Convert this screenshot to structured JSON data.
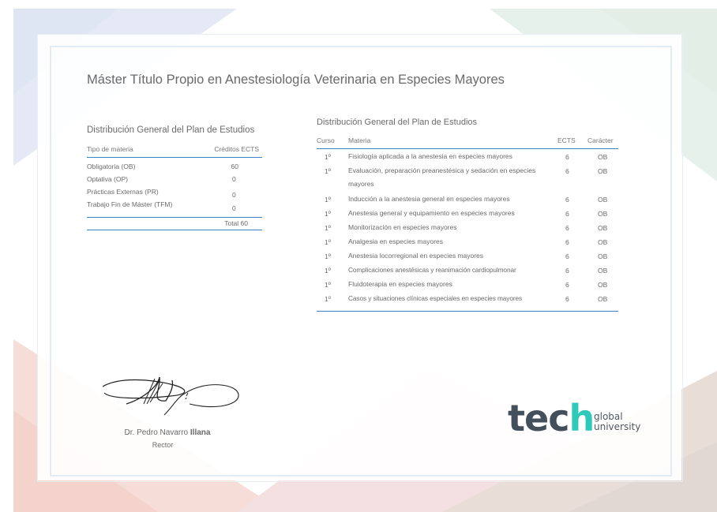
{
  "document": {
    "title": "Máster Título Propio en Anestesiología Veterinaria en Especies Mayores"
  },
  "summary_table": {
    "title": "Distribución General del Plan de Estudios",
    "headers": [
      "Tipo de materia",
      "Créditos ECTS"
    ],
    "rows": [
      {
        "type": "Obligatoria (OB)",
        "credits": "60"
      },
      {
        "type": "Optativa (OP)",
        "credits": "0"
      },
      {
        "type": "Prácticas Externas (PR)",
        "credits": "0"
      },
      {
        "type": "Trabajo Fin de Máster (TFM)",
        "credits": "0"
      }
    ],
    "total": "Total 60"
  },
  "plan_table": {
    "title": "Distribución General del Plan de Estudios",
    "headers": [
      "Curso",
      "Materia",
      "ECTS",
      "Carácter"
    ],
    "rows": [
      {
        "course": "1º",
        "subject": "Fisiología aplicada a la anestesia en especies mayores",
        "ects": "6",
        "type": "OB"
      },
      {
        "course": "1º",
        "subject": "Evaluación, preparación preanestésica y sedación en especies mayores",
        "ects": "6",
        "type": "OB"
      },
      {
        "course": "1º",
        "subject": "Inducción a la anestesia general en especies mayores",
        "ects": "6",
        "type": "OB"
      },
      {
        "course": "1º",
        "subject": "Anestesia general y equipamiento en especies mayores",
        "ects": "6",
        "type": "OB"
      },
      {
        "course": "1º",
        "subject": "Monitorización en especies mayores",
        "ects": "6",
        "type": "OB"
      },
      {
        "course": "1º",
        "subject": "Analgesia en especies mayores",
        "ects": "6",
        "type": "OB"
      },
      {
        "course": "1º",
        "subject": "Anestesia locorregional en especies mayores",
        "ects": "6",
        "type": "OB"
      },
      {
        "course": "1º",
        "subject": "Complicaciones anestésicas y reanimación cardiopulmonar",
        "ects": "6",
        "type": "OB"
      },
      {
        "course": "1º",
        "subject": "Fluidoterapia en especies mayores",
        "ects": "6",
        "type": "OB"
      },
      {
        "course": "1º",
        "subject": "Casos y situaciones clínicas especiales en especies mayores",
        "ects": "6",
        "type": "OB"
      }
    ]
  },
  "signature": {
    "name_prefix": "Dr. Pedro Navarro ",
    "name_bold": "Illana",
    "role": "Rector"
  },
  "logo": {
    "text_main": "tec",
    "text_accent": "h",
    "sub_line1": "global",
    "sub_line2": "university",
    "accent_color": "#2ec9b8",
    "main_color": "#43505c"
  },
  "colors": {
    "table_rule": "#3b82c8"
  }
}
